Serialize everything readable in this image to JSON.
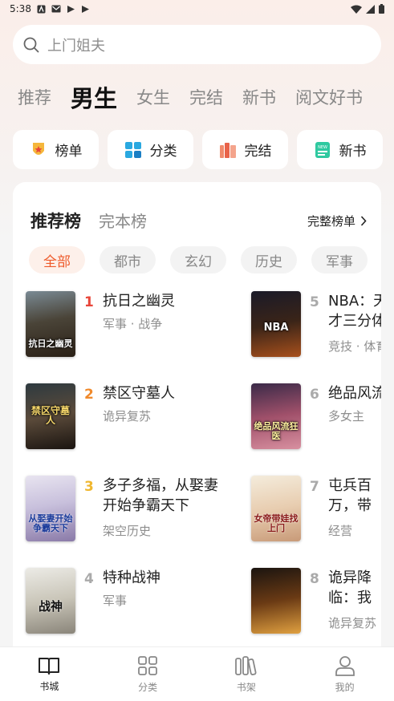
{
  "status_bar": {
    "time": "5:38"
  },
  "search": {
    "placeholder": "上门姐夫"
  },
  "top_tabs": [
    {
      "label": "推荐",
      "active": false
    },
    {
      "label": "男生",
      "active": true
    },
    {
      "label": "女生",
      "active": false
    },
    {
      "label": "完结",
      "active": false
    },
    {
      "label": "新书",
      "active": false
    },
    {
      "label": "阅文好书",
      "active": false
    }
  ],
  "quick_links": [
    {
      "label": "榜单",
      "icon": "medal-icon"
    },
    {
      "label": "分类",
      "icon": "grid-icon"
    },
    {
      "label": "完结",
      "icon": "books-icon"
    },
    {
      "label": "新书",
      "icon": "new-book-icon"
    }
  ],
  "rank_card": {
    "tabs": [
      {
        "label": "推荐榜",
        "active": true
      },
      {
        "label": "完本榜",
        "active": false
      }
    ],
    "full_rank_label": "完整榜单",
    "chips": [
      {
        "label": "全部",
        "active": true
      },
      {
        "label": "都市",
        "active": false
      },
      {
        "label": "玄幻",
        "active": false
      },
      {
        "label": "历史",
        "active": false
      },
      {
        "label": "军事",
        "active": false
      }
    ],
    "books": [
      {
        "rank": "1",
        "title": "抗日之幽灵",
        "meta": "军事 · 战争",
        "cover_text": "抗日之幽灵"
      },
      {
        "rank": "2",
        "title": "禁区守墓人",
        "meta": "诡异复苏",
        "cover_text": "禁区守墓人"
      },
      {
        "rank": "3",
        "title": "多子多福，从娶妻开始争霸天下",
        "meta": "架空历史",
        "cover_text": "从娶妻开始争霸天下"
      },
      {
        "rank": "4",
        "title": "特种战神",
        "meta": "军事",
        "cover_text": "战神"
      },
      {
        "rank": "5",
        "title": "NBA：天才三分体系",
        "meta": "竞技 · 体育",
        "cover_text": "NBA"
      },
      {
        "rank": "6",
        "title": "绝品风流狂医",
        "meta": "多女主",
        "cover_text": "绝品风流狂医"
      },
      {
        "rank": "7",
        "title": "屯兵百万，带娃找上门",
        "meta": "经营",
        "cover_text": "女帝带娃找上门"
      },
      {
        "rank": "8",
        "title": "诡异降临：我是十殿阎王",
        "meta": "诡异复苏",
        "cover_text": ""
      }
    ]
  },
  "bottom_nav": [
    {
      "label": "书城",
      "icon": "book-open-icon",
      "active": true
    },
    {
      "label": "分类",
      "icon": "grid-icon",
      "active": false
    },
    {
      "label": "书架",
      "icon": "bookshelf-icon",
      "active": false
    },
    {
      "label": "我的",
      "icon": "user-icon",
      "active": false
    }
  ],
  "colors": {
    "accent": "#ee5a2b",
    "rank1": "#e8463a",
    "rank2": "#f08a2c",
    "rank3": "#f0b72f",
    "muted": "#8e8e8e"
  }
}
